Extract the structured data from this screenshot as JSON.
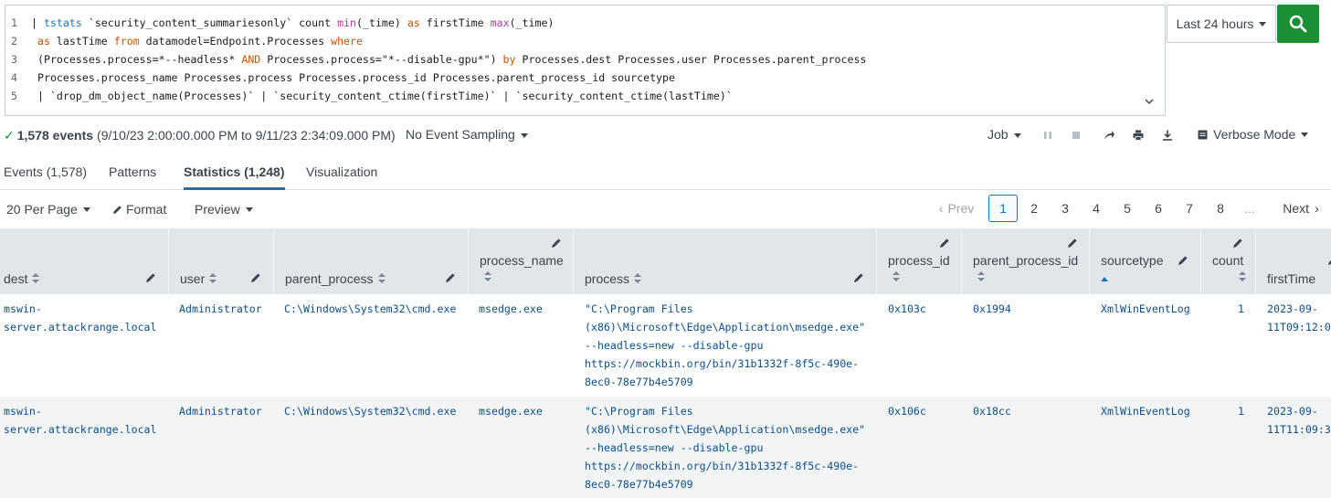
{
  "search": {
    "lines": [
      {
        "num": "1",
        "parts": [
          {
            "t": "| ",
            "c": ""
          },
          {
            "t": "tstats",
            "c": "blue"
          },
          {
            "t": " `security_content_summariesonly` count ",
            "c": ""
          },
          {
            "t": "min",
            "c": "purple"
          },
          {
            "t": "(_time) ",
            "c": ""
          },
          {
            "t": "as",
            "c": "orange"
          },
          {
            "t": " firstTime ",
            "c": ""
          },
          {
            "t": "max",
            "c": "purple"
          },
          {
            "t": "(_time)",
            "c": ""
          }
        ]
      },
      {
        "num": "2",
        "parts": [
          {
            "t": " ",
            "c": ""
          },
          {
            "t": "as",
            "c": "orange"
          },
          {
            "t": " lastTime ",
            "c": ""
          },
          {
            "t": "from",
            "c": "orange"
          },
          {
            "t": " datamodel=Endpoint.Processes ",
            "c": ""
          },
          {
            "t": "where",
            "c": "orange"
          }
        ]
      },
      {
        "num": "3",
        "parts": [
          {
            "t": " (Processes.process=*--headless* ",
            "c": ""
          },
          {
            "t": "AND",
            "c": "orange"
          },
          {
            "t": " Processes.process=\"*--disable-gpu*\") ",
            "c": ""
          },
          {
            "t": "by",
            "c": "orange"
          },
          {
            "t": " Processes.dest Processes.user Processes.parent_process",
            "c": ""
          }
        ]
      },
      {
        "num": "4",
        "parts": [
          {
            "t": " Processes.process_name Processes.process Processes.process_id Processes.parent_process_id sourcetype",
            "c": ""
          }
        ]
      },
      {
        "num": "5",
        "parts": [
          {
            "t": " | `drop_dm_object_name(Processes)` | `security_content_ctime(firstTime)` | `security_content_ctime(lastTime)`",
            "c": ""
          }
        ]
      }
    ],
    "time_range": "Last 24 hours"
  },
  "status": {
    "event_count": "1,578 events",
    "range": "(9/10/23 2:00:00.000 PM to 9/11/23 2:34:09.000 PM)",
    "sampling": "No Event Sampling",
    "job": "Job",
    "mode": "Verbose Mode"
  },
  "tabs": [
    "Events (1,578)",
    "Patterns",
    "Statistics (1,248)",
    "Visualization"
  ],
  "toolbar": {
    "per_page": "20 Per Page",
    "format": "Format",
    "preview": "Preview",
    "prev": "Prev",
    "next": "Next",
    "pages": [
      "1",
      "2",
      "3",
      "4",
      "5",
      "6",
      "7",
      "8"
    ],
    "ellipsis": "..."
  },
  "table": {
    "columns": [
      "dest",
      "user",
      "parent_process",
      "process_name",
      "process",
      "process_id",
      "parent_process_id",
      "sourcetype",
      "count",
      "firstTime"
    ],
    "rows": [
      {
        "dest": "mswin-\nserver.attackrange.local",
        "user": "Administrator",
        "parent_process": "C:\\Windows\\System32\\cmd.exe",
        "process_name": "msedge.exe",
        "process": "\"C:\\Program Files\n(x86)\\Microsoft\\Edge\\Application\\msedge.exe\"\n--headless=new --disable-gpu\nhttps://mockbin.org/bin/31b1332f-8f5c-490e-\n8ec0-78e77b4e5709",
        "process_id": "0x103c",
        "parent_process_id": "0x1994",
        "sourcetype": "XmlWinEventLog",
        "count": "1",
        "firstTime": "2023-09-\n11T09:12:0"
      },
      {
        "dest": "mswin-\nserver.attackrange.local",
        "user": "Administrator",
        "parent_process": "C:\\Windows\\System32\\cmd.exe",
        "process_name": "msedge.exe",
        "process": "\"C:\\Program Files\n(x86)\\Microsoft\\Edge\\Application\\msedge.exe\"\n--headless=new --disable-gpu\nhttps://mockbin.org/bin/31b1332f-8f5c-490e-\n8ec0-78e77b4e5709",
        "process_id": "0x106c",
        "parent_process_id": "0x18cc",
        "sourcetype": "XmlWinEventLog",
        "count": "1",
        "firstTime": "2023-09-\n11T11:09:3"
      }
    ]
  },
  "colors": {
    "accent": "#1a73b8",
    "search_button": "#1a9035",
    "header_bg": "#e1e6eb",
    "cell_text": "#0b4f8a"
  },
  "icons": {
    "search": "search-icon",
    "pause": "pause-icon",
    "stop": "stop-icon",
    "share": "share-icon",
    "print": "print-icon",
    "export": "export-icon",
    "pencil": "pencil-icon",
    "format": "pencil-icon"
  }
}
